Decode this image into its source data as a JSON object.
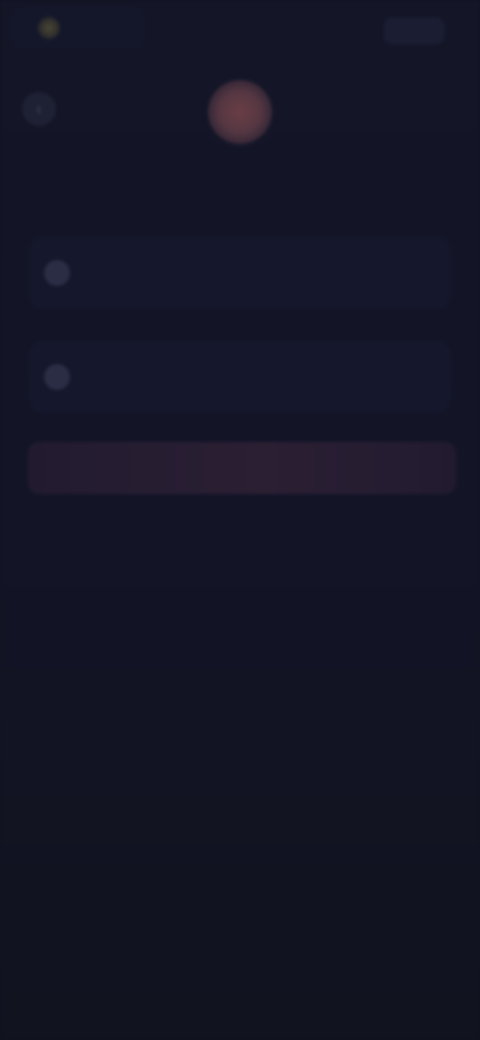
{
  "header": {
    "brand_name": "",
    "right_button_label": ""
  },
  "main": {
    "title": "",
    "options": [
      {
        "label": ""
      },
      {
        "label": ""
      }
    ],
    "primary_button_label": ""
  },
  "colors": {
    "background": "#11131f",
    "accent": "#553741"
  }
}
